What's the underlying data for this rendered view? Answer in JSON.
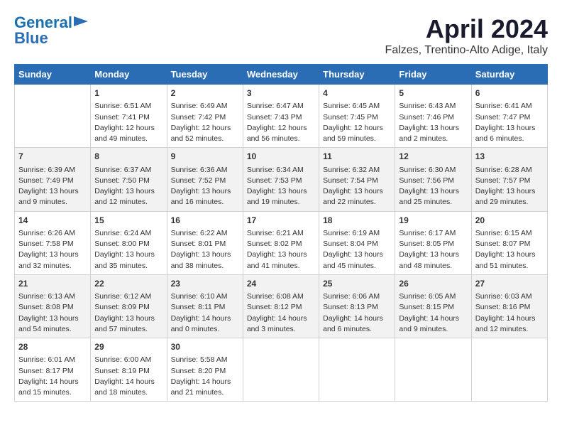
{
  "header": {
    "logo_line1": "General",
    "logo_line2": "Blue",
    "month": "April 2024",
    "location": "Falzes, Trentino-Alto Adige, Italy"
  },
  "columns": [
    "Sunday",
    "Monday",
    "Tuesday",
    "Wednesday",
    "Thursday",
    "Friday",
    "Saturday"
  ],
  "weeks": [
    [
      {
        "day": "",
        "info": ""
      },
      {
        "day": "1",
        "info": "Sunrise: 6:51 AM\nSunset: 7:41 PM\nDaylight: 12 hours\nand 49 minutes."
      },
      {
        "day": "2",
        "info": "Sunrise: 6:49 AM\nSunset: 7:42 PM\nDaylight: 12 hours\nand 52 minutes."
      },
      {
        "day": "3",
        "info": "Sunrise: 6:47 AM\nSunset: 7:43 PM\nDaylight: 12 hours\nand 56 minutes."
      },
      {
        "day": "4",
        "info": "Sunrise: 6:45 AM\nSunset: 7:45 PM\nDaylight: 12 hours\nand 59 minutes."
      },
      {
        "day": "5",
        "info": "Sunrise: 6:43 AM\nSunset: 7:46 PM\nDaylight: 13 hours\nand 2 minutes."
      },
      {
        "day": "6",
        "info": "Sunrise: 6:41 AM\nSunset: 7:47 PM\nDaylight: 13 hours\nand 6 minutes."
      }
    ],
    [
      {
        "day": "7",
        "info": "Sunrise: 6:39 AM\nSunset: 7:49 PM\nDaylight: 13 hours\nand 9 minutes."
      },
      {
        "day": "8",
        "info": "Sunrise: 6:37 AM\nSunset: 7:50 PM\nDaylight: 13 hours\nand 12 minutes."
      },
      {
        "day": "9",
        "info": "Sunrise: 6:36 AM\nSunset: 7:52 PM\nDaylight: 13 hours\nand 16 minutes."
      },
      {
        "day": "10",
        "info": "Sunrise: 6:34 AM\nSunset: 7:53 PM\nDaylight: 13 hours\nand 19 minutes."
      },
      {
        "day": "11",
        "info": "Sunrise: 6:32 AM\nSunset: 7:54 PM\nDaylight: 13 hours\nand 22 minutes."
      },
      {
        "day": "12",
        "info": "Sunrise: 6:30 AM\nSunset: 7:56 PM\nDaylight: 13 hours\nand 25 minutes."
      },
      {
        "day": "13",
        "info": "Sunrise: 6:28 AM\nSunset: 7:57 PM\nDaylight: 13 hours\nand 29 minutes."
      }
    ],
    [
      {
        "day": "14",
        "info": "Sunrise: 6:26 AM\nSunset: 7:58 PM\nDaylight: 13 hours\nand 32 minutes."
      },
      {
        "day": "15",
        "info": "Sunrise: 6:24 AM\nSunset: 8:00 PM\nDaylight: 13 hours\nand 35 minutes."
      },
      {
        "day": "16",
        "info": "Sunrise: 6:22 AM\nSunset: 8:01 PM\nDaylight: 13 hours\nand 38 minutes."
      },
      {
        "day": "17",
        "info": "Sunrise: 6:21 AM\nSunset: 8:02 PM\nDaylight: 13 hours\nand 41 minutes."
      },
      {
        "day": "18",
        "info": "Sunrise: 6:19 AM\nSunset: 8:04 PM\nDaylight: 13 hours\nand 45 minutes."
      },
      {
        "day": "19",
        "info": "Sunrise: 6:17 AM\nSunset: 8:05 PM\nDaylight: 13 hours\nand 48 minutes."
      },
      {
        "day": "20",
        "info": "Sunrise: 6:15 AM\nSunset: 8:07 PM\nDaylight: 13 hours\nand 51 minutes."
      }
    ],
    [
      {
        "day": "21",
        "info": "Sunrise: 6:13 AM\nSunset: 8:08 PM\nDaylight: 13 hours\nand 54 minutes."
      },
      {
        "day": "22",
        "info": "Sunrise: 6:12 AM\nSunset: 8:09 PM\nDaylight: 13 hours\nand 57 minutes."
      },
      {
        "day": "23",
        "info": "Sunrise: 6:10 AM\nSunset: 8:11 PM\nDaylight: 14 hours\nand 0 minutes."
      },
      {
        "day": "24",
        "info": "Sunrise: 6:08 AM\nSunset: 8:12 PM\nDaylight: 14 hours\nand 3 minutes."
      },
      {
        "day": "25",
        "info": "Sunrise: 6:06 AM\nSunset: 8:13 PM\nDaylight: 14 hours\nand 6 minutes."
      },
      {
        "day": "26",
        "info": "Sunrise: 6:05 AM\nSunset: 8:15 PM\nDaylight: 14 hours\nand 9 minutes."
      },
      {
        "day": "27",
        "info": "Sunrise: 6:03 AM\nSunset: 8:16 PM\nDaylight: 14 hours\nand 12 minutes."
      }
    ],
    [
      {
        "day": "28",
        "info": "Sunrise: 6:01 AM\nSunset: 8:17 PM\nDaylight: 14 hours\nand 15 minutes."
      },
      {
        "day": "29",
        "info": "Sunrise: 6:00 AM\nSunset: 8:19 PM\nDaylight: 14 hours\nand 18 minutes."
      },
      {
        "day": "30",
        "info": "Sunrise: 5:58 AM\nSunset: 8:20 PM\nDaylight: 14 hours\nand 21 minutes."
      },
      {
        "day": "",
        "info": ""
      },
      {
        "day": "",
        "info": ""
      },
      {
        "day": "",
        "info": ""
      },
      {
        "day": "",
        "info": ""
      }
    ]
  ]
}
